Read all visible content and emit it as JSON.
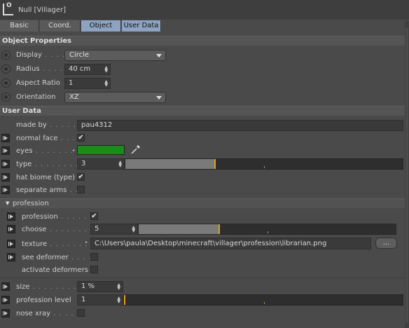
{
  "window": {
    "title": "Null [Villager]"
  },
  "tabs": [
    {
      "label": "Basic",
      "active": false
    },
    {
      "label": "Coord.",
      "active": false
    },
    {
      "label": "Object",
      "active": true
    },
    {
      "label": "User Data",
      "active": true
    }
  ],
  "object_properties": {
    "title": "Object Properties",
    "display": {
      "label": "Display",
      "dots": " . . . .",
      "value": "Circle"
    },
    "radius": {
      "label": "Radius",
      "dots": " . . . . .",
      "value": "40 cm"
    },
    "aspect_ratio": {
      "label": "Aspect Ratio",
      "value": "1"
    },
    "orientation": {
      "label": "Orientation",
      "value": "XZ"
    }
  },
  "user_data": {
    "title": "User Data",
    "made_by": {
      "label": "made by",
      "dots": " . . . . . .",
      "value": "pau4312"
    },
    "normal_face": {
      "label": "normal face",
      "dots": " . . .",
      "checked": true
    },
    "eyes": {
      "label": "eyes",
      "dots": " . . . . . . . . .",
      "color": "#1a8c1a"
    },
    "type": {
      "label": "type",
      "dots": " . . . . . . . . .",
      "value": "3",
      "fraction": 0.32
    },
    "hat_biome": {
      "label": "hat biome (type)",
      "checked": true
    },
    "separate_arms": {
      "label": "separate arms",
      "dots": " . .",
      "checked": false
    }
  },
  "profession": {
    "title": "profession",
    "profession": {
      "label": "profession",
      "dots": " . . . . . .",
      "checked": true
    },
    "choose": {
      "label": "choose",
      "dots": " . . . . . . . . .",
      "value": "5",
      "fraction": 0.31
    },
    "texture": {
      "label": "texture",
      "dots": " . . . . . . . . .",
      "value": "C:\\Users\\paula\\Desktop\\minecraft\\villager\\profession\\librarian.png",
      "button": "..."
    },
    "see_deformer": {
      "label": "see deformer",
      "dots": " . . . .",
      "checked": false
    },
    "activate_deformers": {
      "label": "activate deformers",
      "checked": false
    }
  },
  "misc": {
    "size": {
      "label": "size",
      "dots": " . . . . . . . . . . .",
      "value": "1 %"
    },
    "profession_level": {
      "label": "profession level",
      "value": "1",
      "fraction": 0.0
    },
    "nose_xray": {
      "label": "nose xray",
      "dots": " . . . . .",
      "checked": false
    }
  },
  "colors": {
    "accent": "#8ea3c2",
    "slider_marker": "#e0a020",
    "eyes_swatch": "#1a8c1a"
  }
}
